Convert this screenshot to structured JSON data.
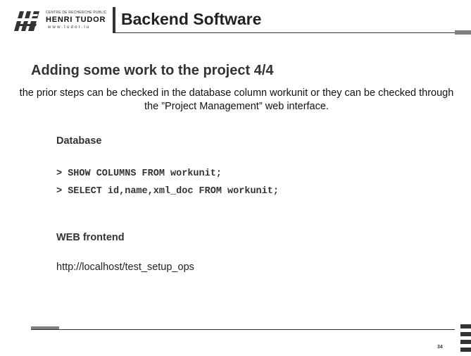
{
  "logo": {
    "line1": "CENTRE DE RECHERCHE PUBLIC",
    "line2": "HENRI TUDOR",
    "line3": "www.tudor.lu"
  },
  "slide": {
    "title": "Backend Software",
    "heading": "Adding some work to the project 4/4",
    "description": "the prior steps can be checked in the database column workunit or they can be checked through the ”Project Management” web interface.",
    "database_label": "Database",
    "commands": [
      "> SHOW COLUMNS FROM workunit;",
      "> SELECT id,name,xml_doc FROM workunit;"
    ],
    "web_label": "WEB frontend",
    "url": "http://localhost/test_setup_ops",
    "page_number": "34"
  }
}
